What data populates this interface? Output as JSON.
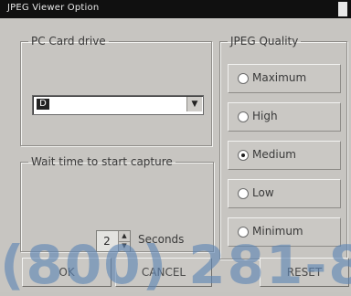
{
  "window": {
    "title": "JPEG Viewer Option"
  },
  "pc_card": {
    "legend": "PC Card drive",
    "selected_drive": "D"
  },
  "wait_time": {
    "legend": "Wait time to start capture",
    "value": "2",
    "unit": "Seconds"
  },
  "jpeg_quality": {
    "legend": "JPEG Quality",
    "options": [
      {
        "label": "Maximum",
        "checked": false
      },
      {
        "label": "High",
        "checked": false
      },
      {
        "label": "Medium",
        "checked": true
      },
      {
        "label": "Low",
        "checked": false
      },
      {
        "label": "Minimum",
        "checked": false
      }
    ]
  },
  "buttons": {
    "ok": "OK",
    "cancel": "CANCEL",
    "reset": "RESET"
  },
  "watermark": {
    "phone": "(800) 281-8"
  },
  "colors": {
    "background": "#c6c4c0",
    "titlebar": "#101010",
    "watermark": "#5e86b5"
  }
}
